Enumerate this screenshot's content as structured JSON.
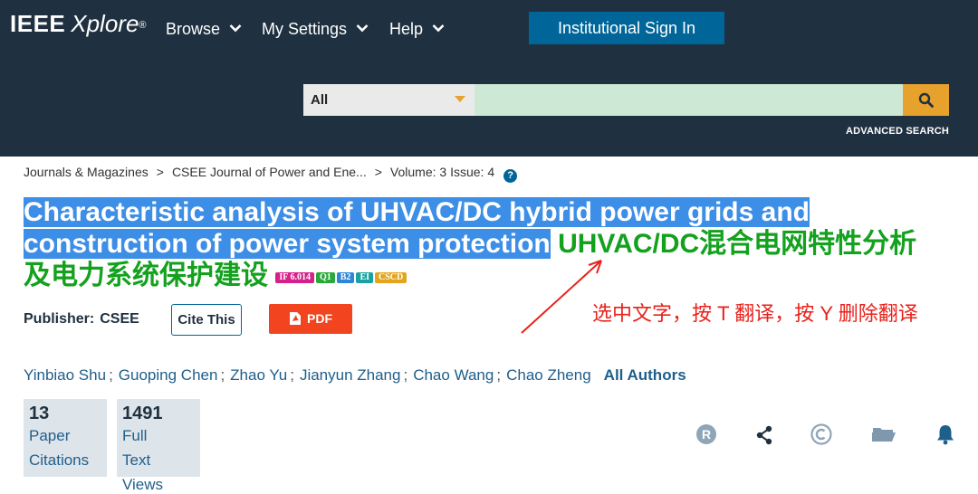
{
  "header": {
    "logo_ieee": "IEEE",
    "logo_xplore": "Xplore",
    "logo_reg": "®",
    "nav": [
      {
        "label": "Browse"
      },
      {
        "label": "My Settings"
      },
      {
        "label": "Help"
      }
    ],
    "sign_in_label": "Institutional Sign In",
    "search": {
      "scope_selected": "All",
      "query": "",
      "button_icon": "search-icon"
    },
    "advanced_search_label": "ADVANCED SEARCH"
  },
  "breadcrumb": {
    "items": [
      "Journals & Magazines",
      "CSEE Journal of Power and Ene...",
      "Volume: 3 Issue: 4"
    ],
    "separator": ">",
    "help_icon": "?"
  },
  "article": {
    "title_en": "Characteristic analysis of UHVAC/DC hybrid power grids and construction of power system protection",
    "title_cn_line1": "UHVAC/DC混合电网特性分析",
    "title_cn_line2": "及电力系统保护建设",
    "badges": [
      {
        "label": "IF 6.014",
        "color": "#d6208a"
      },
      {
        "label": "Q1",
        "color": "#29a93a"
      },
      {
        "label": "B2",
        "color": "#2f86d8"
      },
      {
        "label": "EI",
        "color": "#1aa2a2"
      },
      {
        "label": "CSCD",
        "color": "#e3a51f"
      }
    ],
    "publisher_label": "Publisher:",
    "publisher_value": "CSEE",
    "cite_label": "Cite This",
    "pdf_label": "PDF"
  },
  "annotation": {
    "text": "选中文字，按 T 翻译，按 Y 删除翻译",
    "color": "#e8221b"
  },
  "authors": {
    "list": [
      "Yinbiao Shu",
      "Guoping Chen",
      "Zhao Yu",
      "Jianyun Zhang",
      "Chao Wang",
      "Chao Zheng"
    ],
    "separator": ";",
    "all_authors_label": "All Authors"
  },
  "metrics": [
    {
      "value": "13",
      "label_lines": [
        "Paper",
        "Citations"
      ]
    },
    {
      "value": "1491",
      "label_lines": [
        "Full",
        "Text",
        "Views"
      ]
    }
  ],
  "toolbar_icons": [
    "rights-icon",
    "share-icon",
    "copyright-icon",
    "folder-icon",
    "bell-icon"
  ],
  "colors": {
    "header_bg": "#1f3140",
    "accent_blue": "#006699",
    "search_button": "#e6a22d",
    "pdf_button": "#f2451f",
    "title_highlight": "#3d8ee6",
    "translation_green": "#13a11e"
  }
}
